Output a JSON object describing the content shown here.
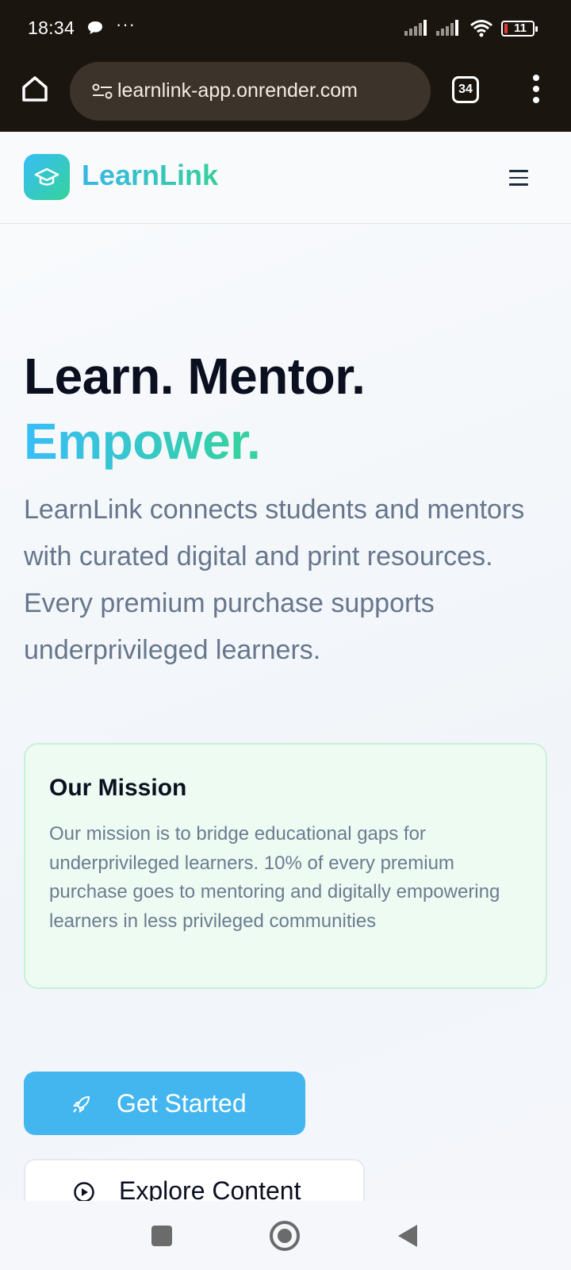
{
  "status_bar": {
    "time": "18:34",
    "more": "···",
    "battery": "11"
  },
  "browser": {
    "url": "learnlink-app.onrender.com",
    "tab_count": "34"
  },
  "header": {
    "brand": "LearnLink"
  },
  "hero": {
    "title": "Learn. Mentor.",
    "accent": "Empower.",
    "description": "LearnLink connects students and mentors with curated digital and print resources. Every premium purchase supports underprivileged learners."
  },
  "mission": {
    "title": "Our Mission",
    "text": "Our mission is to bridge educational gaps for underprivileged learners. 10% of every premium purchase goes to mentoring and digitally empowering learners in less privileged communities"
  },
  "actions": {
    "primary_label": "Get Started",
    "secondary_label": "Explore Content"
  },
  "colors": {
    "accent_blue": "#38bdf8",
    "accent_green": "#34d399",
    "primary_button": "#44b6ef",
    "mission_bg": "#eefbf3",
    "text_dark": "#0b1020",
    "text_muted": "#66768c"
  },
  "icons": {
    "logo": "graduation-cap-icon",
    "menu": "hamburger-icon",
    "primary": "rocket-icon",
    "secondary": "play-circle-icon"
  }
}
